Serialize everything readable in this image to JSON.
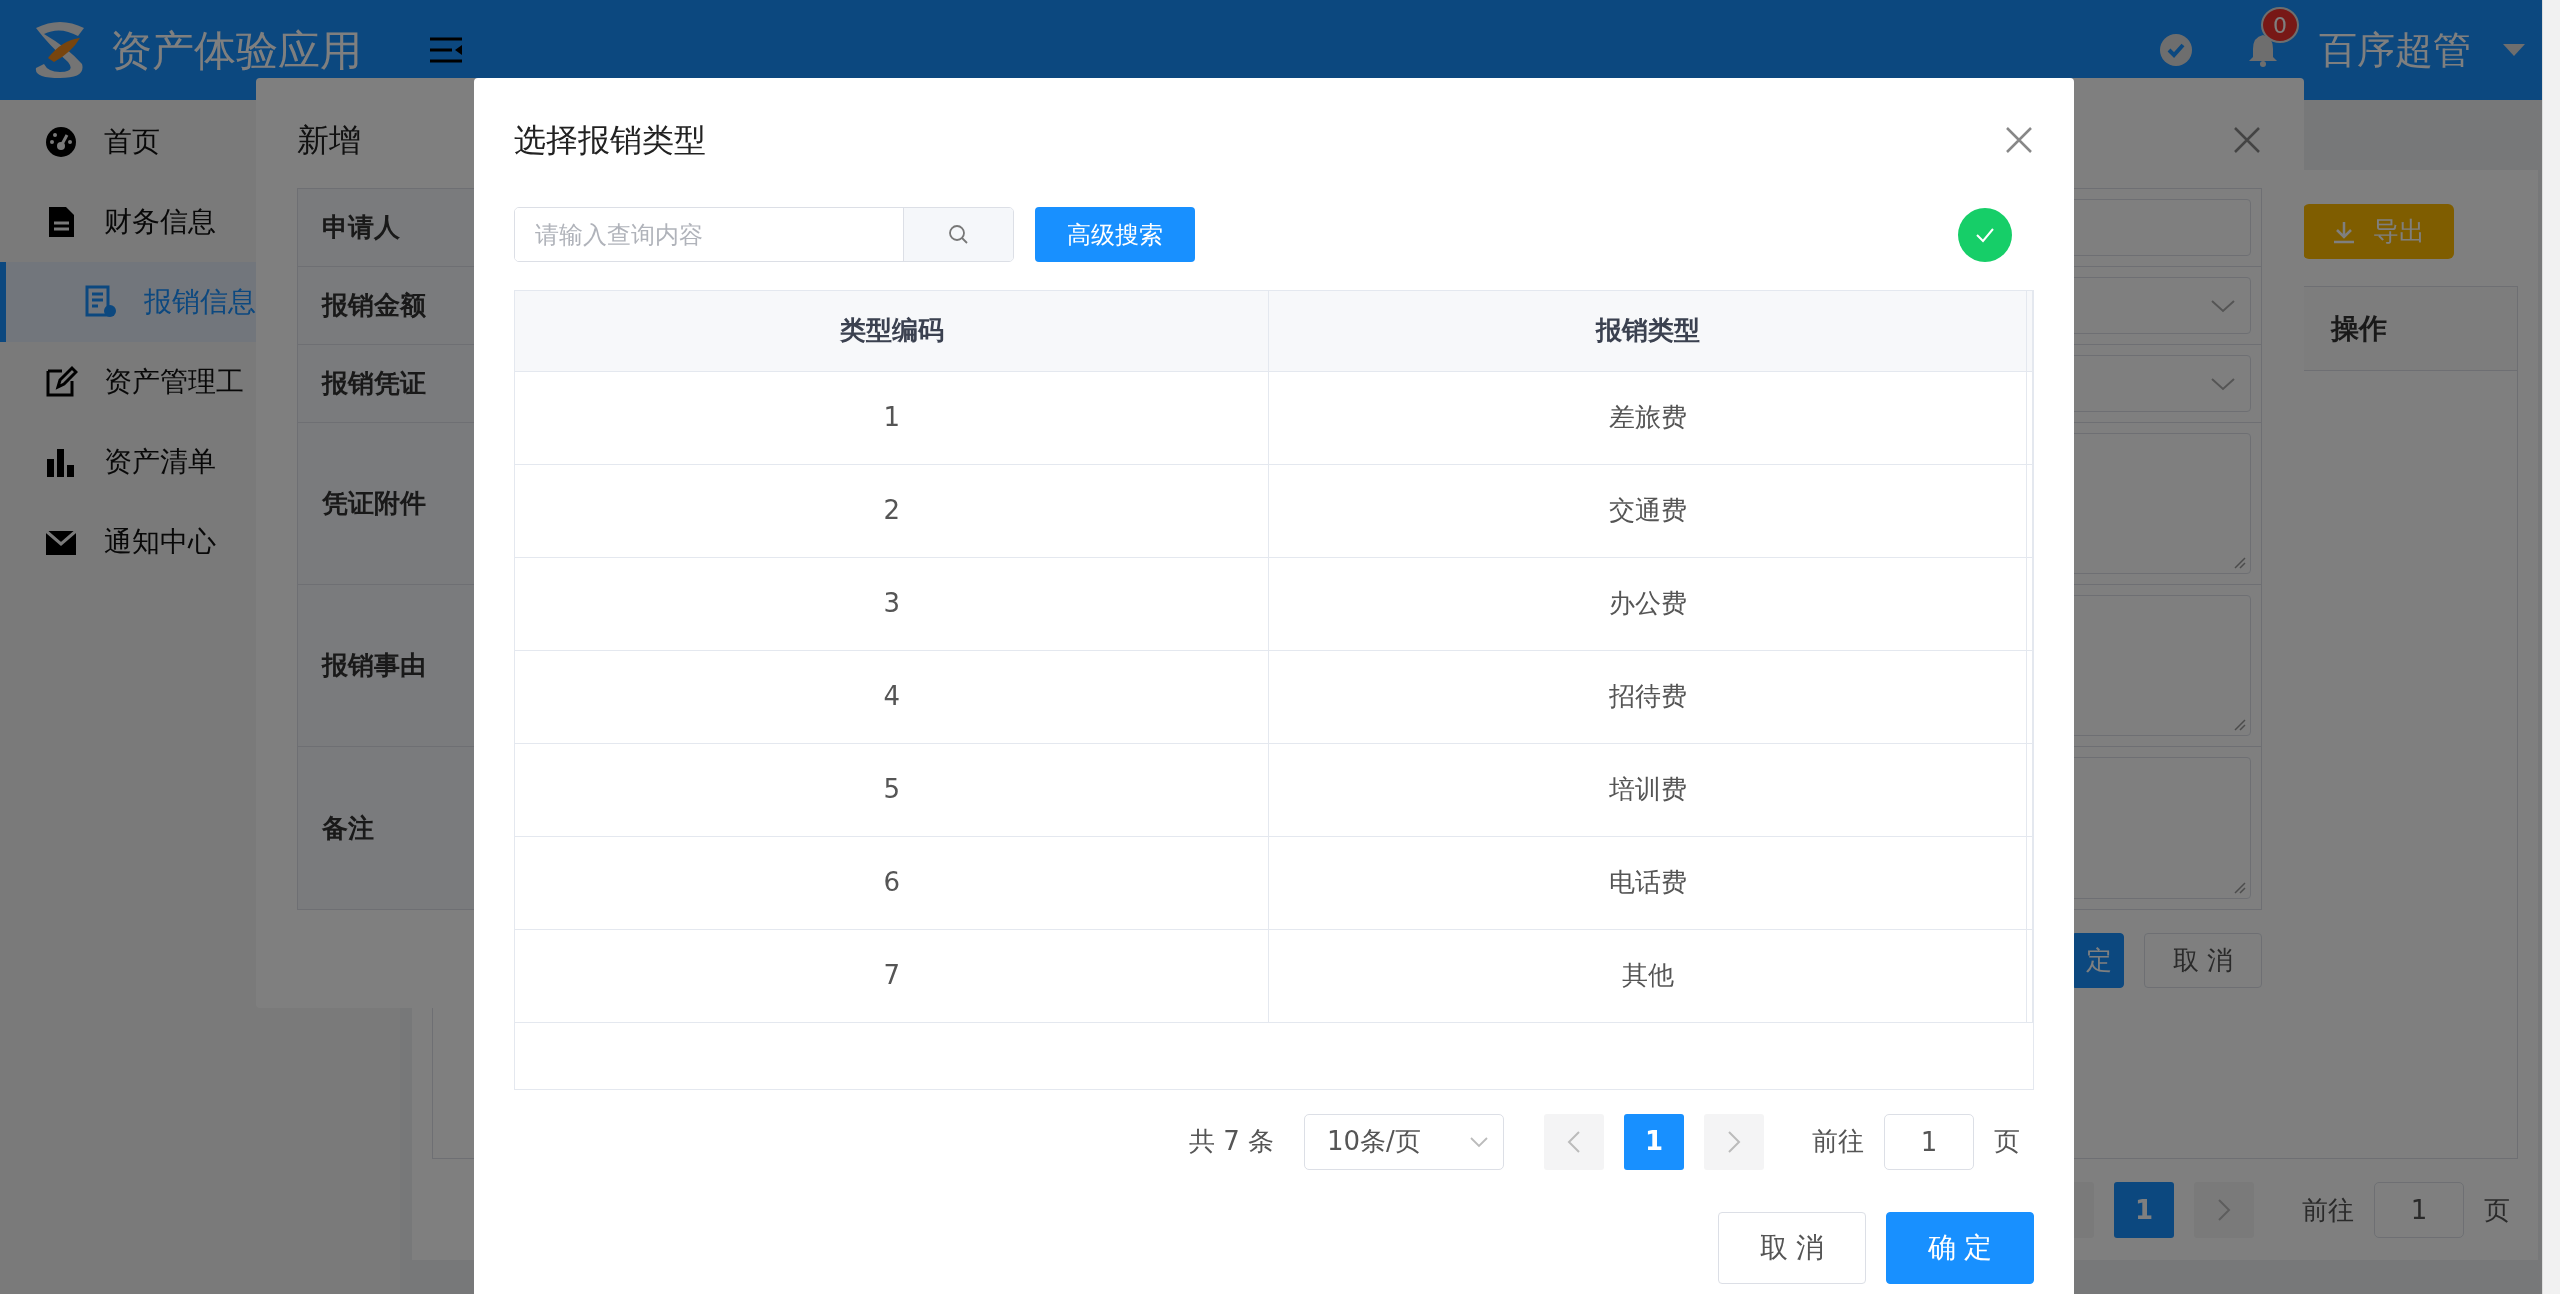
{
  "header": {
    "app_title": "资产体验应用",
    "notification_count": "0",
    "user_name": "百序超管"
  },
  "sidebar": {
    "items": [
      {
        "label": "首页",
        "selected": false
      },
      {
        "label": "财务信息",
        "selected": false,
        "expanded": true,
        "children": [
          {
            "label": "报销信息",
            "selected": true
          }
        ]
      },
      {
        "label": "资产管理工",
        "selected": false
      },
      {
        "label": "资产清单",
        "selected": false
      },
      {
        "label": "通知中心",
        "selected": false
      }
    ]
  },
  "page": {
    "export_button": "导出",
    "table": {
      "columns": [
        "操作"
      ]
    },
    "pagination": {
      "pages": [
        {
          "label": "1",
          "selected": true
        }
      ],
      "goto_label": "前往",
      "goto_value": "1",
      "page_suffix": "页"
    }
  },
  "add_dialog": {
    "title": "新增",
    "form": [
      {
        "label": "申请人",
        "kind": "text"
      },
      {
        "label": "报销金额",
        "kind": "select"
      },
      {
        "label": "报销凭证",
        "kind": "select"
      },
      {
        "label": "凭证附件",
        "kind": "textarea"
      },
      {
        "label": "报销事由",
        "kind": "textarea"
      },
      {
        "label": "备注",
        "kind": "textarea"
      }
    ],
    "buttons": [
      {
        "label": "定",
        "kind": "primary"
      },
      {
        "label": "取 消",
        "kind": "default"
      }
    ]
  },
  "select_dialog": {
    "title": "选择报销类型",
    "search": {
      "placeholder": "请输入查询内容"
    },
    "advanced_search_button": "高级搜索",
    "table": {
      "columns": [
        "类型编码",
        "报销类型"
      ],
      "rows": [
        [
          "1",
          "差旅费"
        ],
        [
          "2",
          "交通费"
        ],
        [
          "3",
          "办公费"
        ],
        [
          "4",
          "招待费"
        ],
        [
          "5",
          "培训费"
        ],
        [
          "6",
          "电话费"
        ],
        [
          "7",
          "其他"
        ]
      ]
    },
    "pagination": {
      "total": "共 7 条",
      "page_size": "10条/页",
      "pages": [
        {
          "label": "1",
          "selected": true
        }
      ],
      "goto_label": "前往",
      "goto_value": "1",
      "page_suffix": "页"
    },
    "buttons": [
      {
        "label": "取 消",
        "kind": "default"
      },
      {
        "label": "确 定",
        "kind": "primary"
      }
    ]
  }
}
